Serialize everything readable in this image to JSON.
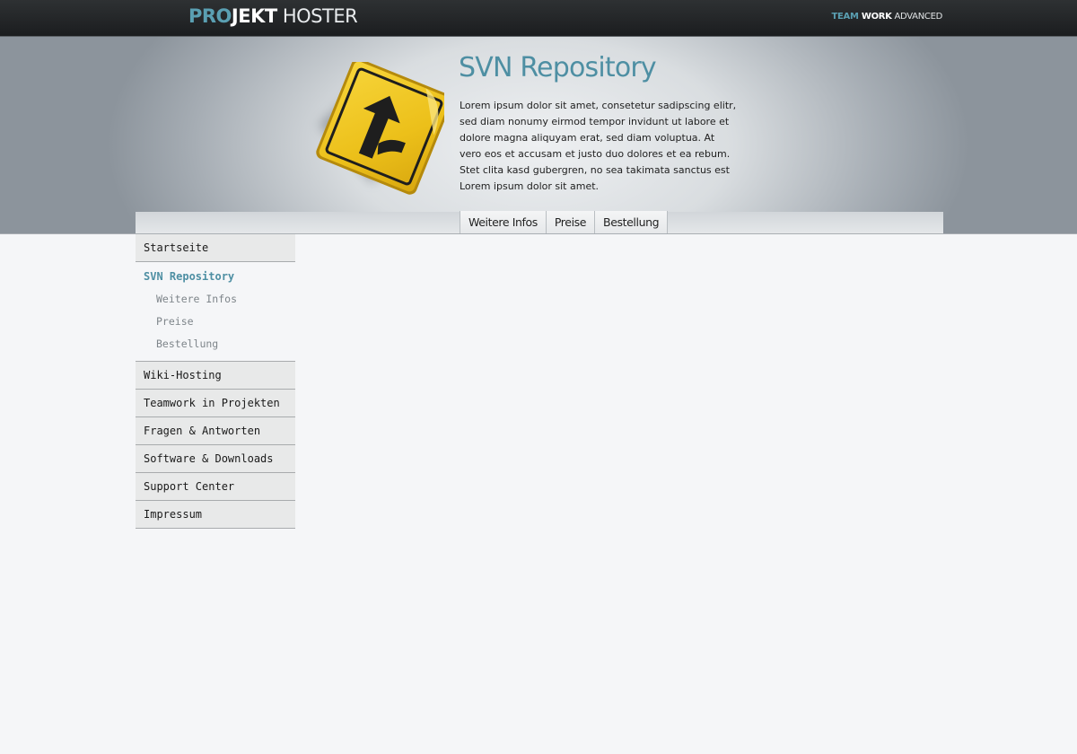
{
  "brand": {
    "logo_part1": "PRO",
    "logo_part2": "JEKT",
    "logo_part3": " HOSTER",
    "tag_part1": "TEAM",
    "tag_part2": " WORK",
    "tag_part3": " ADVANCED"
  },
  "banner": {
    "title": "SVN Repository",
    "intro": "Lorem ipsum dolor sit amet, consetetur sadipscing elitr, sed diam nonumy eirmod tempor invidunt ut labore et dolore magna aliquyam erat, sed diam voluptua. At vero eos et accusam et justo duo dolores et ea rebum. Stet clita kasd gubergren, no sea takimata sanctus est Lorem ipsum dolor sit amet.",
    "icon": "merge-road-sign-icon"
  },
  "subnav": {
    "tabs": [
      {
        "label": "Weitere Infos"
      },
      {
        "label": "Preise"
      },
      {
        "label": "Bestellung"
      }
    ]
  },
  "sidebar": {
    "items": [
      {
        "label": "Startseite"
      },
      {
        "label": "SVN Repository",
        "active": true
      },
      {
        "label": "Weitere Infos"
      },
      {
        "label": "Preise"
      },
      {
        "label": "Bestellung"
      },
      {
        "label": "Wiki-Hosting"
      },
      {
        "label": "Teamwork in Projekten"
      },
      {
        "label": "Fragen & Antworten"
      },
      {
        "label": "Software & Downloads"
      },
      {
        "label": "Support Center"
      },
      {
        "label": "Impressum"
      }
    ]
  },
  "colors": {
    "accent": "#4e8fa3",
    "topbar": "#1f2224",
    "sign_yellow": "#f0c419"
  }
}
